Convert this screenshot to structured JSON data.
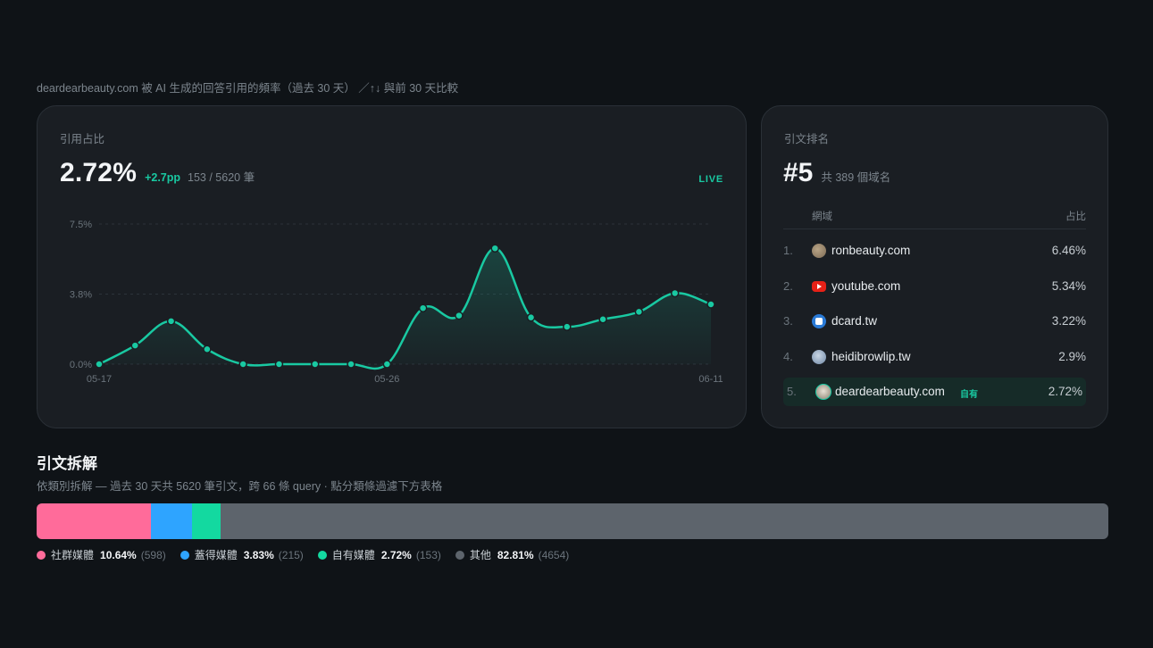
{
  "header": {
    "subtitle": "deardearbeauty.com 被 AI 生成的回答引用的頻率（過去 30 天） ／↑↓ 與前 30 天比較"
  },
  "share_card": {
    "label": "引用占比",
    "value": "2.72%",
    "delta": "+2.7pp",
    "count": "153 / 5620 筆",
    "live": "LIVE"
  },
  "rank_card": {
    "label": "引文排名",
    "rank": "#5",
    "total": "共 389 個域名",
    "col_domain": "網域",
    "col_share": "占比",
    "items": [
      {
        "num": "1.",
        "domain": "ronbeauty.com",
        "share": "6.46%",
        "icon": "ronbeauty-favicon-icon",
        "tag": ""
      },
      {
        "num": "2.",
        "domain": "youtube.com",
        "share": "5.34%",
        "icon": "youtube-icon",
        "tag": ""
      },
      {
        "num": "3.",
        "domain": "dcard.tw",
        "share": "3.22%",
        "icon": "dcard-icon",
        "tag": ""
      },
      {
        "num": "4.",
        "domain": "heidibrowlip.tw",
        "share": "2.9%",
        "icon": "globe-icon",
        "tag": ""
      },
      {
        "num": "5.",
        "domain": "deardearbeauty.com",
        "share": "2.72%",
        "icon": "deardearbeauty-favicon-icon",
        "tag": "自有"
      }
    ]
  },
  "chart_data": {
    "type": "area",
    "title": "",
    "xlabel": "",
    "ylabel": "",
    "x_tick_labels": [
      "05-17",
      "05-26",
      "06-11"
    ],
    "y_tick_labels": [
      "7.5%",
      "3.8%",
      "0.0%"
    ],
    "ylim": [
      0,
      7.5
    ],
    "grid": true,
    "color": "#19c9a2",
    "values": [
      0.0,
      1.0,
      2.3,
      0.8,
      0.0,
      0.0,
      0.0,
      0.0,
      0.0,
      3.0,
      2.6,
      6.2,
      2.5,
      2.0,
      2.4,
      2.8,
      3.8,
      3.2
    ]
  },
  "breakdown": {
    "title": "引文拆解",
    "subtitle": "依類別拆解 — 過去 30 天共 5620 筆引文，跨 66 條 query · 點分類條過濾下方表格",
    "categories": [
      {
        "name": "社群媒體",
        "pct": "10.64%",
        "count": "(598)",
        "fraction": 0.1064,
        "color": "#ff6b9a"
      },
      {
        "name": "蓋得媒體",
        "pct": "3.83%",
        "count": "(215)",
        "fraction": 0.0383,
        "color": "#2ea4ff"
      },
      {
        "name": "自有媒體",
        "pct": "2.72%",
        "count": "(153)",
        "fraction": 0.0272,
        "color": "#13d9a0"
      },
      {
        "name": "其他",
        "pct": "82.81%",
        "count": "(4654)",
        "fraction": 0.8281,
        "color": "#5d646c"
      }
    ]
  }
}
